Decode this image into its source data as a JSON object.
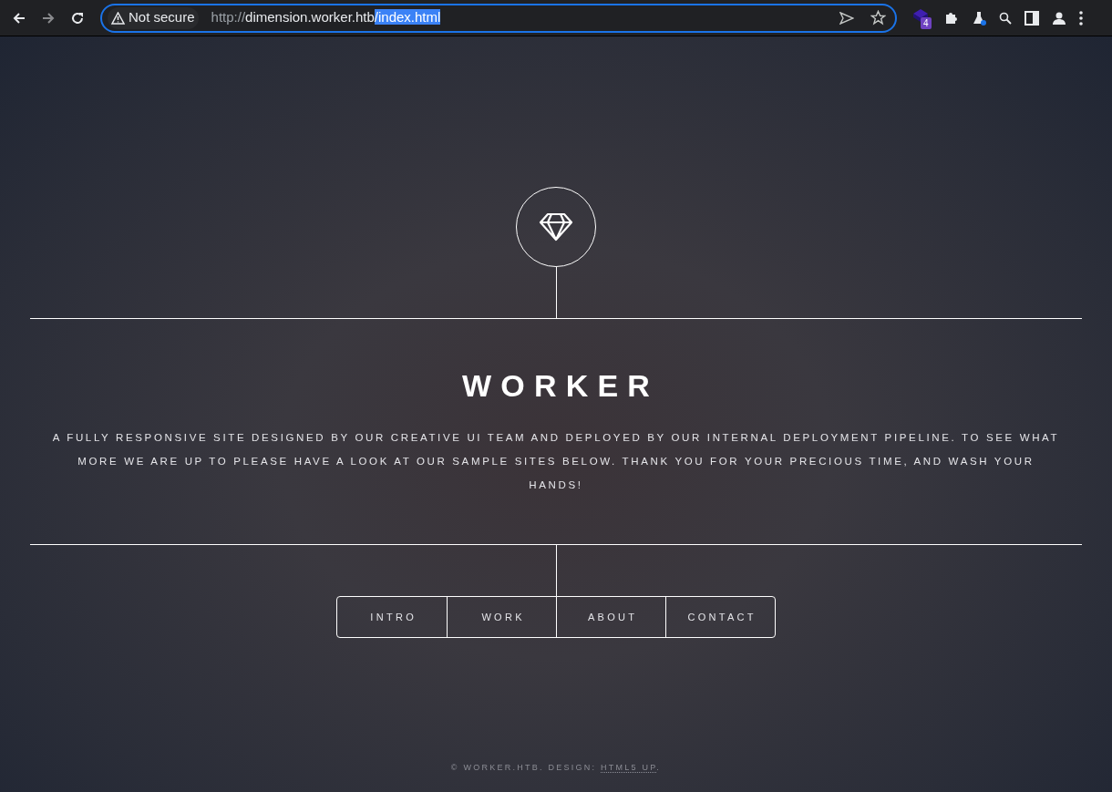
{
  "browser": {
    "security": "Not secure",
    "url_scheme": "http://",
    "url_host": "dimension.worker.htb",
    "url_path": "/index.html",
    "url_path_selected": true,
    "extension_badge": "4"
  },
  "header": {
    "title": "WORKER",
    "description": "A FULLY RESPONSIVE SITE DESIGNED BY OUR CREATIVE UI TEAM AND DEPLOYED BY OUR INTERNAL DEPLOYMENT PIPELINE. TO SEE WHAT MORE WE ARE UP TO PLEASE HAVE A LOOK AT OUR SAMPLE SITES BELOW. THANK YOU FOR YOUR PRECIOUS TIME, AND WASH YOUR HANDS!"
  },
  "nav": [
    {
      "label": "INTRO"
    },
    {
      "label": "WORK"
    },
    {
      "label": "ABOUT"
    },
    {
      "label": "CONTACT"
    }
  ],
  "footer": {
    "text": "© WORKER.HTB. DESIGN:",
    "link": "HTML5 UP",
    "end": "."
  }
}
